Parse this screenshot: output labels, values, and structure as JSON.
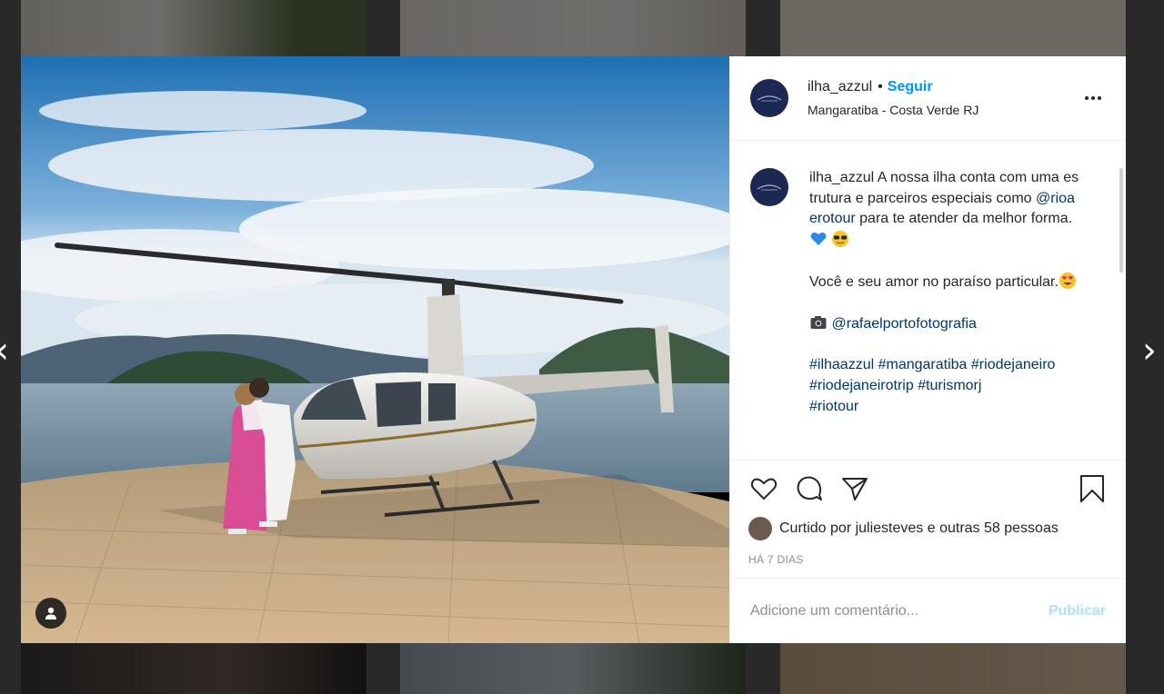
{
  "post": {
    "username": "ilha_azzul",
    "separator": "•",
    "follow_label": "Seguir",
    "location": "Mangaratiba - Costa Verde RJ",
    "more_icon": "more-options-icon"
  },
  "caption": {
    "username": "ilha_azzul",
    "text_part1": " A nossa ilha conta com uma estrutura e parceiros especiais como ",
    "mention1": "@rioaerotour",
    "text_part2": " para te atender da melhor forma. ",
    "paragraph2": "Você e seu amor no paraíso particular.",
    "camera_mention": "@rafaelportofotografia",
    "hashtags_line1": [
      "#ilhaazzul",
      "#mangaratiba",
      "#riodejaneiro"
    ],
    "hashtags_line2": [
      "#riodejaneirotrip",
      "#turismorj"
    ],
    "hashtags_line3": [
      "#riotour"
    ]
  },
  "actions": {
    "likes_text": "Curtido por juliesteves e outras 58 pessoas",
    "timestamp": "HÁ 7 DIAS"
  },
  "comment": {
    "placeholder": "Adicione um comentário...",
    "publish_label": "Publicar"
  },
  "colors": {
    "accent": "#0095f6",
    "link": "#00376b",
    "publish_disabled": "#b2dffc"
  }
}
